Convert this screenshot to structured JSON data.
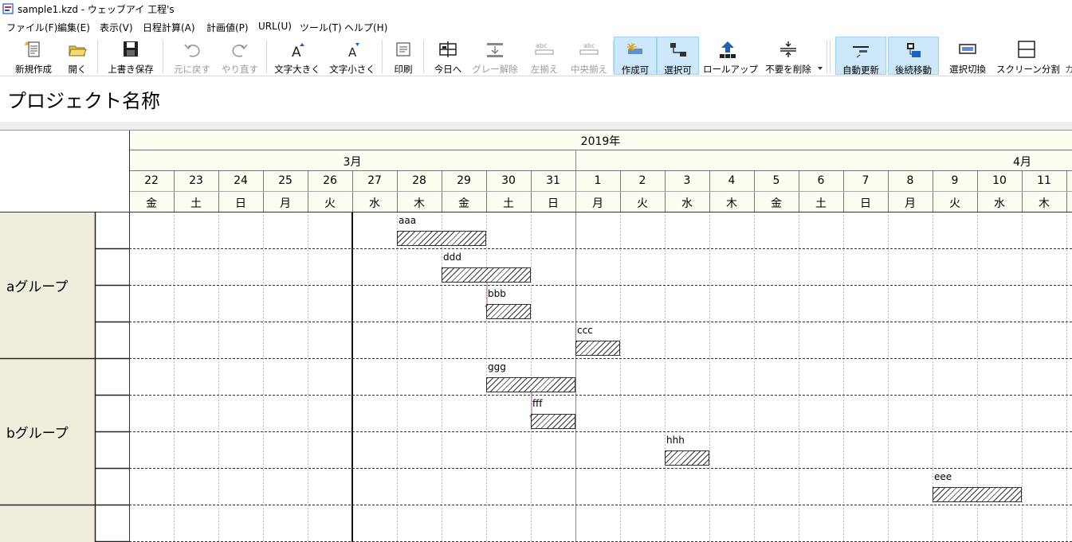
{
  "window": {
    "title": "sample1.kzd - ウェッブアイ 工程's"
  },
  "menu": [
    "ファイル(F)",
    "編集(E)",
    "表示(V)",
    "日程計算(A)",
    "計画値(P)",
    "URL(U)",
    "ツール(T)",
    "ヘルプ(H)"
  ],
  "toolbar": {
    "new": "新規作成",
    "open": "開く",
    "save": "上書き保存",
    "undo": "元に戻す",
    "redo": "やり直す",
    "font_up": "文字大きく",
    "font_down": "文字小さく",
    "print": "印刷",
    "today": "今日へ",
    "gray_clear": "グレー解除",
    "align_left": "左揃え",
    "align_center": "中央揃え",
    "create": "作成可",
    "select": "選択可",
    "rollup": "ロールアップ",
    "delete_unneeded": "不要を削除",
    "auto_update": "自動更新",
    "follow_move": "後続移動",
    "select_toggle": "選択切換",
    "split_screen": "スクリーン分割",
    "overflow_char": "カ",
    "abc": "abc"
  },
  "project": {
    "title": "プロジェクト名称"
  },
  "calendar": {
    "year_label": "2019年",
    "months": [
      {
        "label": "3月"
      },
      {
        "label": "4月"
      }
    ],
    "days": [
      {
        "d": "22",
        "w": "金"
      },
      {
        "d": "23",
        "w": "土"
      },
      {
        "d": "24",
        "w": "日"
      },
      {
        "d": "25",
        "w": "月"
      },
      {
        "d": "26",
        "w": "火"
      },
      {
        "d": "27",
        "w": "水"
      },
      {
        "d": "28",
        "w": "木"
      },
      {
        "d": "29",
        "w": "金"
      },
      {
        "d": "30",
        "w": "土"
      },
      {
        "d": "31",
        "w": "日"
      },
      {
        "d": "1",
        "w": "月"
      },
      {
        "d": "2",
        "w": "火"
      },
      {
        "d": "3",
        "w": "水"
      },
      {
        "d": "4",
        "w": "木"
      },
      {
        "d": "5",
        "w": "金"
      },
      {
        "d": "6",
        "w": "土"
      },
      {
        "d": "7",
        "w": "日"
      },
      {
        "d": "8",
        "w": "月"
      },
      {
        "d": "9",
        "w": "火"
      },
      {
        "d": "10",
        "w": "水"
      },
      {
        "d": "11",
        "w": "木"
      }
    ]
  },
  "groups": [
    {
      "label": "aグループ"
    },
    {
      "label": "bグループ"
    }
  ],
  "tasks": [
    {
      "name": "aaa",
      "start": "03-28",
      "days": 2
    },
    {
      "name": "ddd",
      "start": "03-29",
      "days": 2
    },
    {
      "name": "bbb",
      "start": "03-30",
      "days": 1
    },
    {
      "name": "ccc",
      "start": "04-01",
      "days": 1
    },
    {
      "name": "ggg",
      "start": "03-30",
      "days": 2
    },
    {
      "name": "fff",
      "start": "03-31",
      "days": 1
    },
    {
      "name": "hhh",
      "start": "04-03",
      "days": 1
    },
    {
      "name": "eee",
      "start": "04-09",
      "days": 2
    }
  ],
  "colors": {
    "accent": "#cde8fb",
    "group_bg": "#efeedd",
    "header_bg": "#fdfdf1",
    "dependency": "#b060b0"
  },
  "icons": {
    "new": "new-document-icon",
    "open": "open-folder-icon",
    "save": "floppy-disk-icon",
    "undo": "undo-arrow-icon",
    "redo": "redo-arrow-icon",
    "print": "print-icon"
  }
}
